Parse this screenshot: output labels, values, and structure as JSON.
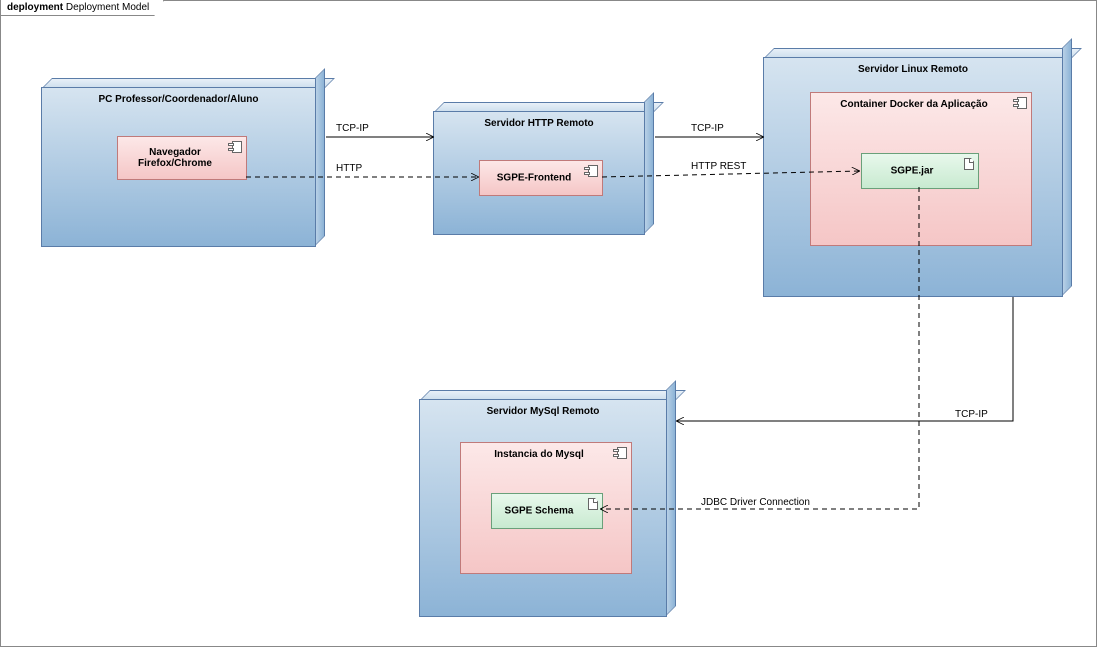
{
  "chart_data": {
    "type": "deployment-diagram",
    "title": "deployment Deployment Model",
    "nodes": [
      {
        "id": "pc",
        "label": "PC Professor/Coordenador/Aluno",
        "components": [
          {
            "id": "browser",
            "label": "Navegador\nFirefox/Chrome"
          }
        ]
      },
      {
        "id": "http-server",
        "label": "Servidor HTTP Remoto",
        "components": [
          {
            "id": "frontend",
            "label": "SGPE-Frontend"
          }
        ]
      },
      {
        "id": "linux-server",
        "label": "Servidor Linux Remoto",
        "components": [
          {
            "id": "docker",
            "label": "Container Docker da Aplicação",
            "artifacts": [
              {
                "id": "jar",
                "label": "SGPE.jar"
              }
            ]
          }
        ]
      },
      {
        "id": "mysql-server",
        "label": "Servidor MySql Remoto",
        "components": [
          {
            "id": "mysql-instance",
            "label": "Instancia do Mysql",
            "artifacts": [
              {
                "id": "schema",
                "label": "SGPE Schema"
              }
            ]
          }
        ]
      }
    ],
    "connections": [
      {
        "from": "pc",
        "to": "http-server",
        "label": "TCP-IP",
        "style": "solid"
      },
      {
        "from": "browser",
        "to": "frontend",
        "label": "HTTP",
        "style": "dashed"
      },
      {
        "from": "http-server",
        "to": "linux-server",
        "label": "TCP-IP",
        "style": "solid"
      },
      {
        "from": "frontend",
        "to": "jar",
        "label": "HTTP REST",
        "style": "dashed"
      },
      {
        "from": "linux-server",
        "to": "mysql-server",
        "label": "TCP-IP",
        "style": "solid"
      },
      {
        "from": "jar",
        "to": "schema",
        "label": "JDBC Driver Connection",
        "style": "dashed"
      }
    ]
  },
  "frame": {
    "kind": "deployment",
    "title": "Deployment Model"
  },
  "nodes": {
    "pc": {
      "title": "PC Professor/Coordenador/Aluno"
    },
    "http_server": {
      "title": "Servidor HTTP Remoto"
    },
    "linux_server": {
      "title": "Servidor Linux Remoto"
    },
    "mysql_server": {
      "title": "Servidor MySql Remoto"
    }
  },
  "components": {
    "browser": {
      "title": "Navegador\nFirefox/Chrome"
    },
    "frontend": {
      "title": "SGPE-Frontend"
    },
    "docker": {
      "title": "Container Docker da Aplicação"
    },
    "mysql_instance": {
      "title": "Instancia do Mysql"
    }
  },
  "artifacts": {
    "jar": {
      "title": "SGPE.jar"
    },
    "schema": {
      "title": "SGPE Schema"
    }
  },
  "labels": {
    "tcp_ip_1": "TCP-IP",
    "http": "HTTP",
    "tcp_ip_2": "TCP-IP",
    "http_rest": "HTTP REST",
    "tcp_ip_3": "TCP-IP",
    "jdbc": "JDBC Driver Connection"
  }
}
